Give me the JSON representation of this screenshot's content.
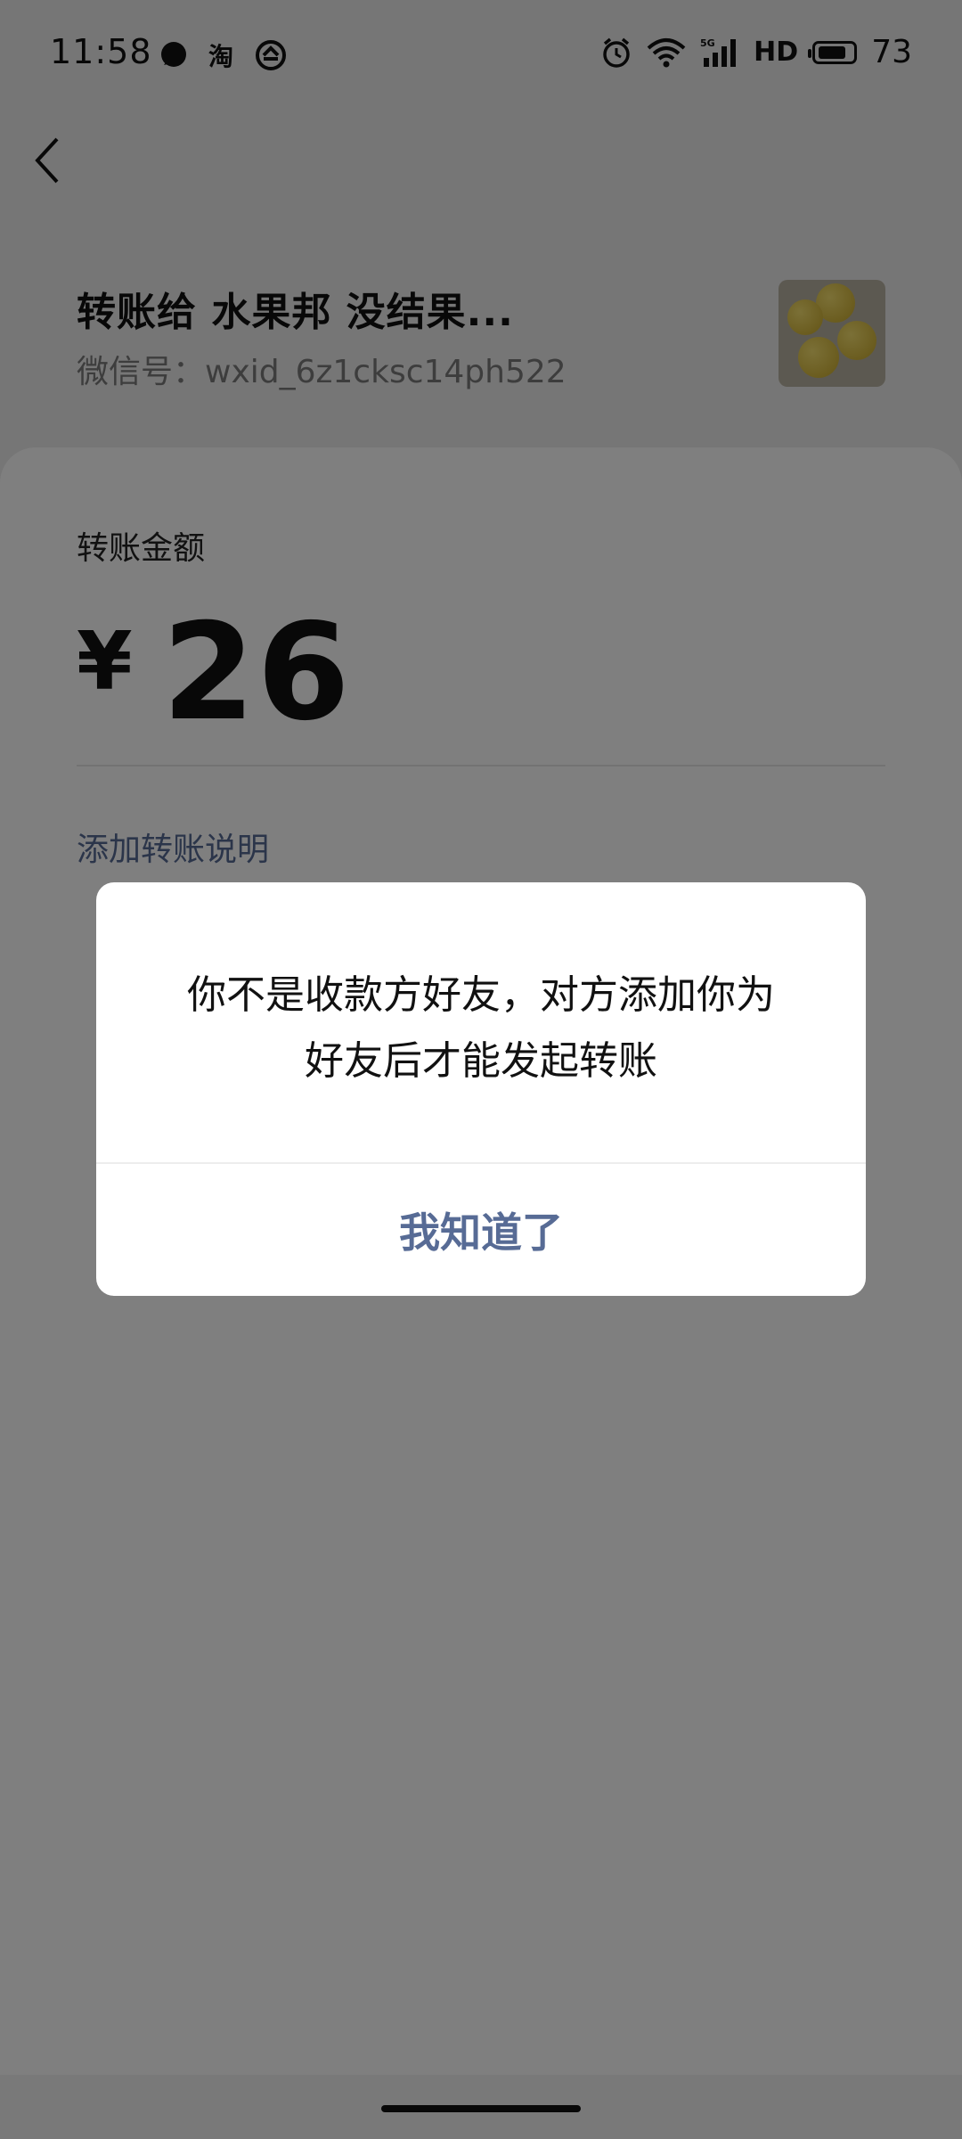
{
  "status_bar": {
    "time": "11:58",
    "left_icons": [
      "chat-bubble-icon",
      "taobao-icon",
      "sync-icon"
    ],
    "right_icons": [
      "alarm-icon",
      "wifi-icon",
      "signal-5g-icon"
    ],
    "network_label": "HD",
    "battery": "73"
  },
  "header": {
    "recipient_title": "转账给 水果邦  没结果...",
    "wechat_id": "微信号：wxid_6z1cksc14ph522"
  },
  "amount": {
    "label": "转账金额",
    "currency": "¥",
    "value": "26",
    "add_note": "添加转账说明"
  },
  "dialog": {
    "line1": "你不是收款方好友，对方添加你为",
    "line2": "好友后才能发起转账",
    "button_label": "我知道了"
  },
  "colors": {
    "link": "#576b95",
    "overlay": "rgba(0,0,0,0.5)"
  }
}
